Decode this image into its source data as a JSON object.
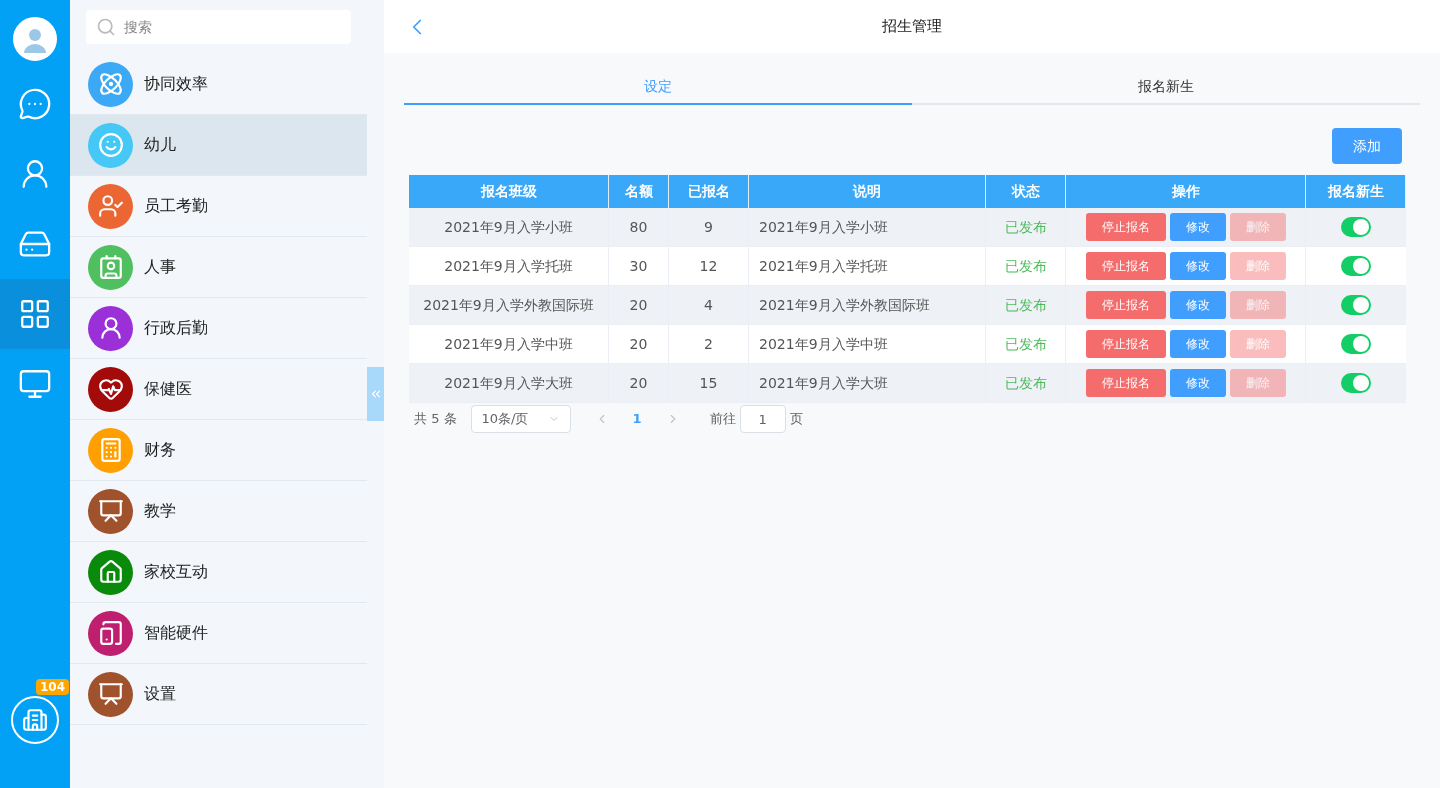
{
  "rail": {
    "badge": "104",
    "items": [
      {
        "selected": false
      },
      {
        "selected": false
      },
      {
        "selected": false
      },
      {
        "selected": true
      },
      {
        "selected": false
      }
    ]
  },
  "sidebar": {
    "search": {
      "placeholder": "搜索"
    },
    "items": [
      {
        "label": "协同效率",
        "color": "#3ba9f5",
        "selected": false
      },
      {
        "label": "幼儿",
        "color": "#45c8f5",
        "selected": true
      },
      {
        "label": "员工考勤",
        "color": "#eb6633",
        "selected": false
      },
      {
        "label": "人事",
        "color": "#4fbf5f",
        "selected": false
      },
      {
        "label": "行政后勤",
        "color": "#9b30d9",
        "selected": false
      },
      {
        "label": "保健医",
        "color": "#a30a0a",
        "selected": false
      },
      {
        "label": "财务",
        "color": "#ffa000",
        "selected": false
      },
      {
        "label": "教学",
        "color": "#a0522d",
        "selected": false
      },
      {
        "label": "家校互动",
        "color": "#0a8a0a",
        "selected": false
      },
      {
        "label": "智能硬件",
        "color": "#bf1f6f",
        "selected": false
      },
      {
        "label": "设置",
        "color": "#a0522d",
        "selected": false
      }
    ]
  },
  "header": {
    "title": "招生管理"
  },
  "tabs": [
    {
      "label": "设定",
      "selected": true
    },
    {
      "label": "报名新生",
      "selected": false
    }
  ],
  "add_button": "添加",
  "table": {
    "columns": [
      "报名班级",
      "名额",
      "已报名",
      "说明",
      "状态",
      "操作",
      "报名新生"
    ],
    "rows": [
      {
        "class": "2021年9月入学小班",
        "quota": "80",
        "enrolled": "9",
        "description": "2021年9月入学小班",
        "status": "已发布",
        "actions": [
          {
            "label": "停止报名",
            "kind": "stop",
            "disabled": false
          },
          {
            "label": "修改",
            "kind": "edit",
            "disabled": false
          },
          {
            "label": "删除",
            "kind": "delete",
            "disabled": true
          }
        ],
        "on": true
      },
      {
        "class": "2021年9月入学托班",
        "quota": "30",
        "enrolled": "12",
        "description": "2021年9月入学托班",
        "status": "已发布",
        "actions": [
          {
            "label": "停止报名",
            "kind": "stop",
            "disabled": false
          },
          {
            "label": "修改",
            "kind": "edit",
            "disabled": false
          },
          {
            "label": "删除",
            "kind": "delete",
            "disabled": true
          }
        ],
        "on": true
      },
      {
        "class": "2021年9月入学外教国际班",
        "quota": "20",
        "enrolled": "4",
        "description": "2021年9月入学外教国际班",
        "status": "已发布",
        "actions": [
          {
            "label": "停止报名",
            "kind": "stop",
            "disabled": false
          },
          {
            "label": "修改",
            "kind": "edit",
            "disabled": false
          },
          {
            "label": "删除",
            "kind": "delete",
            "disabled": true
          }
        ],
        "on": true
      },
      {
        "class": "2021年9月入学中班",
        "quota": "20",
        "enrolled": "2",
        "description": "2021年9月入学中班",
        "status": "已发布",
        "actions": [
          {
            "label": "停止报名",
            "kind": "stop",
            "disabled": false
          },
          {
            "label": "修改",
            "kind": "edit",
            "disabled": false
          },
          {
            "label": "删除",
            "kind": "delete",
            "disabled": true
          }
        ],
        "on": true
      },
      {
        "class": "2021年9月入学大班",
        "quota": "20",
        "enrolled": "15",
        "description": "2021年9月入学大班",
        "status": "已发布",
        "actions": [
          {
            "label": "停止报名",
            "kind": "stop",
            "disabled": false
          },
          {
            "label": "修改",
            "kind": "edit",
            "disabled": false
          },
          {
            "label": "删除",
            "kind": "delete",
            "disabled": true
          }
        ],
        "on": true
      }
    ]
  },
  "pagination": {
    "total": "共 5 条",
    "page_size": "10条/页",
    "pages": [
      {
        "label": "1",
        "selected": true
      }
    ],
    "goto_label": "前往",
    "goto_value": "1",
    "goto_suffix": "页"
  }
}
